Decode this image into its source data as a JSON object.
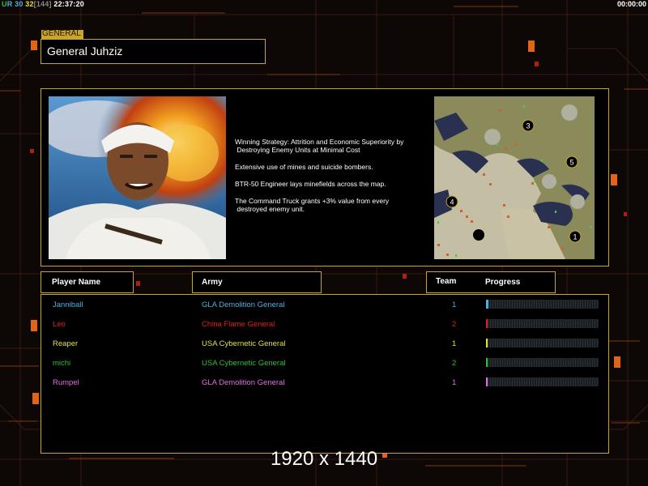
{
  "hud": {
    "top_left": {
      "u": "U",
      "r": "R",
      "n1": "30",
      "n2": "32",
      "n3": "[144]",
      "time": "22:37:20"
    },
    "timer": "00:00:00"
  },
  "general": {
    "tag": "GENERAL",
    "name": "General Juhziz",
    "strategy": [
      "Winning Strategy: Attrition and Economic Superiority by\n Destroying Enemy Units at Minimal Cost",
      "Extensive use of mines and suicide bombers.",
      "BTR-50 Engineer lays minefields across the map.",
      "The Command Truck grants +3% value from every\n destroyed enemy unit."
    ]
  },
  "minimap": {
    "markers": [
      "1",
      "2",
      "3",
      "4",
      "5"
    ]
  },
  "headers": {
    "player_name": "Player Name",
    "army": "Army",
    "team": "Team",
    "progress": "Progress"
  },
  "players": [
    {
      "name": "Janniball",
      "army": "GLA Demolition General",
      "team": "1",
      "color": "#4fb0e0",
      "progress": 0.02
    },
    {
      "name": "Leo",
      "army": "China Flame General",
      "team": "2",
      "color": "#e02020",
      "progress": 0.01
    },
    {
      "name": "Reaper",
      "army": "USA Cybernetic General",
      "team": "1",
      "color": "#e0e040",
      "progress": 0.01
    },
    {
      "name": "michi",
      "army": "USA Cybernetic General",
      "team": "2",
      "color": "#30c030",
      "progress": 0.01
    },
    {
      "name": "Rumpel",
      "army": "GLA Demolition General",
      "team": "1",
      "color": "#e070e0",
      "progress": 0.01
    }
  ],
  "resolution_label": "1920 x 1440"
}
